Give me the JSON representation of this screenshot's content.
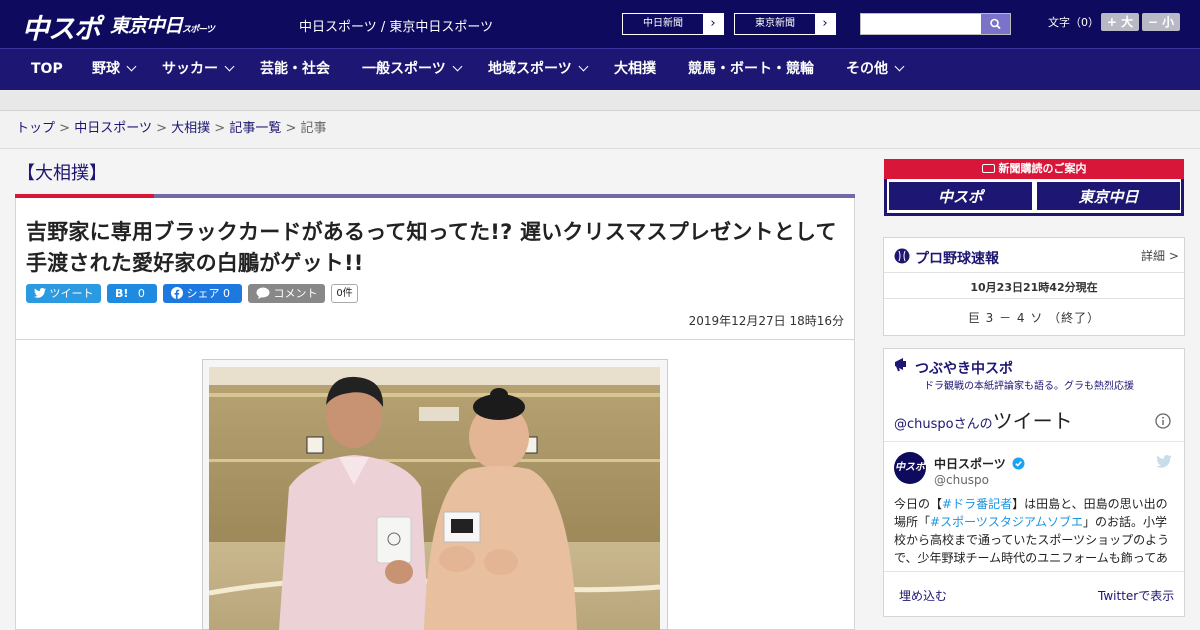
{
  "header": {
    "logo_chuspo": "中スポ",
    "logo_tokyo": "東京中日",
    "logo_tokyo_small": "スポーツ",
    "site_links": "中日スポーツ / 東京中日スポーツ",
    "paper_buttons": [
      "中日新聞",
      "東京新聞"
    ],
    "search_placeholder": "",
    "font_size_label": "文字（0）",
    "font_plus": "+ 大",
    "font_minus": "− 小"
  },
  "nav": {
    "items": [
      {
        "label": "TOP",
        "dropdown": false
      },
      {
        "label": "野球",
        "dropdown": true
      },
      {
        "label": "サッカー",
        "dropdown": true
      },
      {
        "label": "芸能・社会",
        "dropdown": false
      },
      {
        "label": "一般スポーツ",
        "dropdown": true
      },
      {
        "label": "地域スポーツ",
        "dropdown": true
      },
      {
        "label": "大相撲",
        "dropdown": false
      },
      {
        "label": "競馬・ボート・競輪",
        "dropdown": false
      },
      {
        "label": "その他",
        "dropdown": true
      }
    ]
  },
  "breadcrumb": {
    "items": [
      "トップ",
      "中日スポーツ",
      "大相撲",
      "記事一覧"
    ],
    "current": "記事",
    "separator": ">"
  },
  "article": {
    "category": "【大相撲】",
    "title": "吉野家に専用ブラックカードがあるって知ってた!? 遅いクリスマスプレゼントとして手渡された愛好家の白鵬がゲット!!",
    "share": {
      "tweet": "ツイート",
      "hatena": "B!",
      "hatena_count": "0",
      "facebook": "シェア",
      "facebook_count": "0",
      "comment": "コメント",
      "comment_count": "0件"
    },
    "date": "2019年12月27日 18時16分"
  },
  "sidebar": {
    "subscribe": {
      "title": "新聞購読のご案内",
      "buttons": [
        "中スポ",
        "東京中日"
      ]
    },
    "baseball": {
      "title": "プロ野球速報",
      "detail": "詳細 >",
      "time": "10月23日21時42分現在",
      "score": "巨 3 － 4 ソ （終了）"
    },
    "tsubuyaki": {
      "title": "つぶやき中スポ",
      "subtitle": "ドラ観戦の本紙評論家も語る。グラも熱烈応援",
      "head_handle": "@chuspo",
      "head_suffix": "さんの",
      "head_big": "ツイート",
      "tweet_name": "中日スポーツ",
      "tweet_handle": "@chuspo",
      "tweet_text_1": "今日の【",
      "tweet_tag_1": "#ドラ番記者",
      "tweet_text_2": "】は田島と、田島の思い出の場所「",
      "tweet_tag_2": "#スポーツスタジアムソブエ",
      "tweet_text_3": "」のお話。小学校から高校まで通っていたスポーツショップのようで、少年野球チーム時代のユニフォームも飾ってあ",
      "embed": "埋め込む",
      "view": "Twitterで表示"
    }
  },
  "colors": {
    "brand": "#0e0a5e",
    "nav": "#1d1672",
    "accent": "#d8163a"
  }
}
